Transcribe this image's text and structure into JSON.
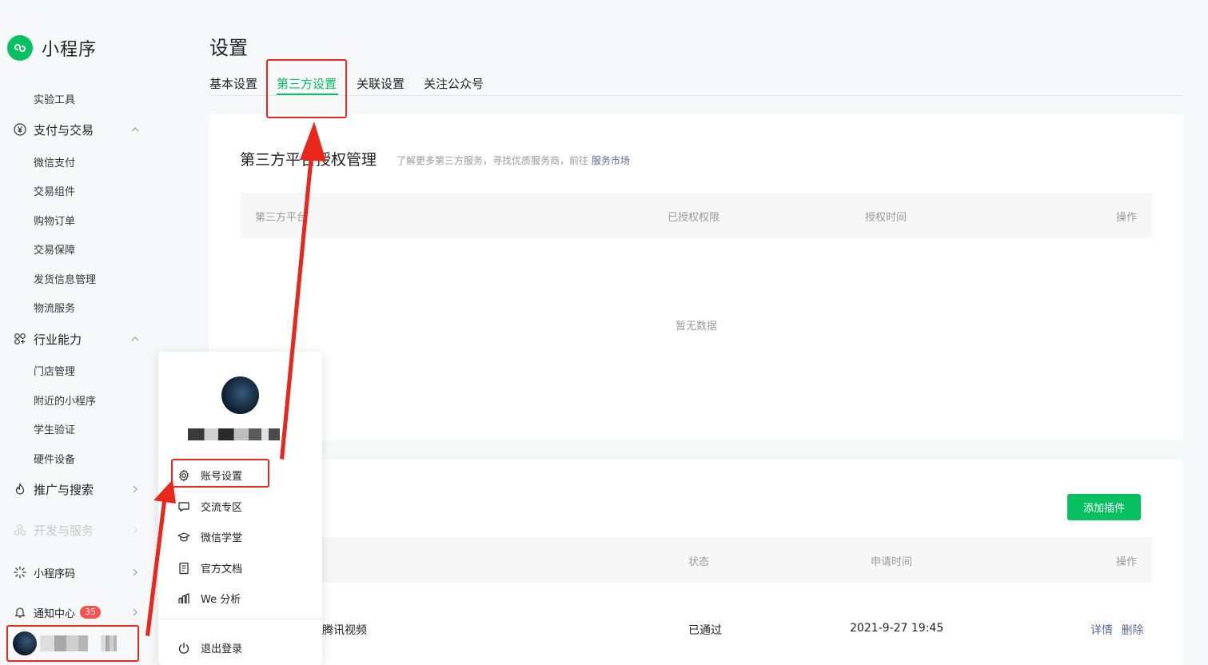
{
  "sidebar": {
    "brand": "小程序",
    "items": [
      {
        "label": "实验工具"
      },
      {
        "label": "支付与交易"
      },
      {
        "label": "微信支付"
      },
      {
        "label": "交易组件"
      },
      {
        "label": "购物订单"
      },
      {
        "label": "交易保障"
      },
      {
        "label": "发货信息管理"
      },
      {
        "label": "物流服务"
      },
      {
        "label": "行业能力"
      },
      {
        "label": "门店管理"
      },
      {
        "label": "附近的小程序"
      },
      {
        "label": "学生验证"
      },
      {
        "label": "硬件设备"
      },
      {
        "label": "推广与搜索"
      },
      {
        "label": "开发与服务"
      },
      {
        "label": "小程序码"
      },
      {
        "label": "通知中心",
        "badge": "35"
      }
    ]
  },
  "page": {
    "title": "设置",
    "tabs": [
      {
        "label": "基本设置"
      },
      {
        "label": "第三方设置"
      },
      {
        "label": "关联设置"
      },
      {
        "label": "关注公众号"
      }
    ]
  },
  "thirdparty": {
    "title": "第三方平台授权管理",
    "hint": "了解更多第三方服务，寻找优质服务商，前往",
    "hint_link": "服务市场",
    "columns": [
      "第三方平台",
      "已授权权限",
      "授权时间",
      "操作"
    ],
    "empty": "暂无数据"
  },
  "plugins": {
    "add_label": "添加插件",
    "columns": [
      "状态",
      "申请时间",
      "操作"
    ],
    "rows": [
      {
        "name": "腾讯视频",
        "status": "已通过",
        "time": "2021-9-27 19:45",
        "detail": "详情",
        "delete": "删除"
      }
    ]
  },
  "popup": {
    "items": [
      {
        "label": "账号设置"
      },
      {
        "label": "交流专区"
      },
      {
        "label": "微信学堂"
      },
      {
        "label": "官方文档"
      },
      {
        "label": "We 分析"
      },
      {
        "label": "退出登录"
      }
    ]
  },
  "colors": {
    "accent": "#07c160",
    "annotation": "#e8281c",
    "link": "#576b95",
    "badge": "#fa5151"
  }
}
